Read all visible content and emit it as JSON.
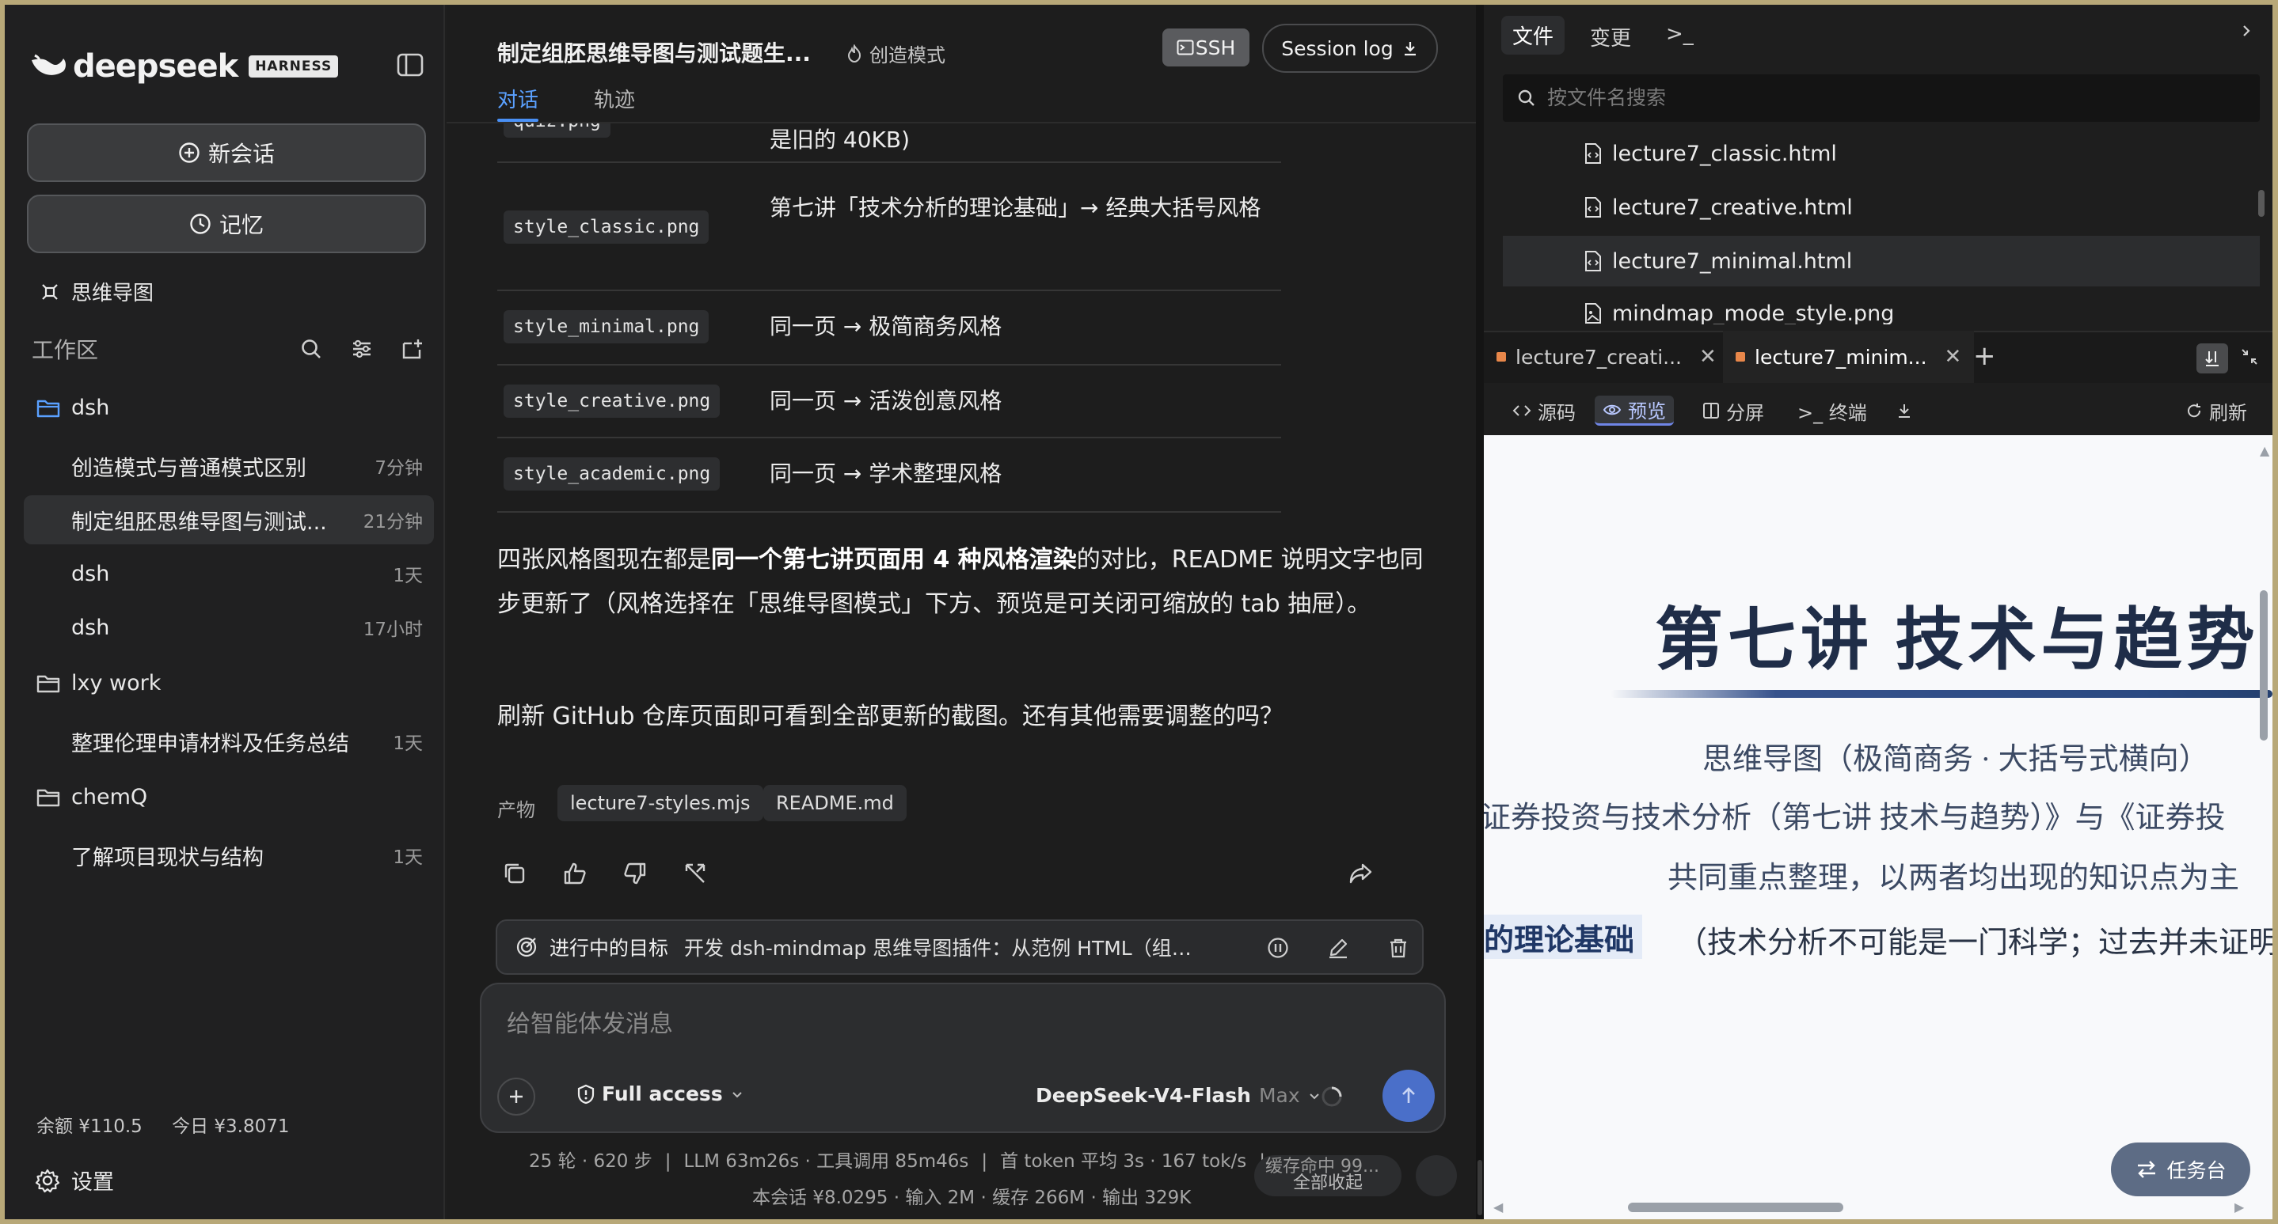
{
  "sidebar": {
    "brand": "deepseek",
    "badge": "HARNESS",
    "new_chat": "新会话",
    "memory": "记忆",
    "mindmap": "思维导图",
    "workspace_label": "工作区",
    "folders": [
      {
        "name": "dsh",
        "sessions": [
          {
            "title": "创造模式与普通模式区别",
            "time": "7分钟"
          },
          {
            "title": "制定组胚思维导图与测试...",
            "time": "21分钟"
          },
          {
            "title": "dsh",
            "time": "1天"
          },
          {
            "title": "dsh",
            "time": "17小时"
          }
        ]
      },
      {
        "name": "lxy work",
        "sessions": [
          {
            "title": "整理伦理申请材料及任务总结",
            "time": "1天"
          }
        ]
      },
      {
        "name": "chemQ",
        "sessions": [
          {
            "title": "了解项目现状与结构",
            "time": "1天"
          }
        ]
      }
    ],
    "balance": "余额 ¥110.5",
    "today": "今日 ¥3.8071",
    "settings": "设置"
  },
  "chat": {
    "title": "制定组胚思维导图与测试题生...",
    "mode": "创造模式",
    "ssh": "SSH",
    "session_log": "Session log",
    "tabs": [
      "对话",
      "轨迹"
    ],
    "partial_top_chip": "quiz.png",
    "partial_top_desc": "是旧的 40KB)",
    "table": [
      {
        "file": "style_classic.png",
        "desc": "第七讲「技术分析的理论基础」→ 经典大括号风格"
      },
      {
        "file": "style_minimal.png",
        "desc": "同一页 → 极简商务风格"
      },
      {
        "file": "style_creative.png",
        "desc": "同一页 → 活泼创意风格"
      },
      {
        "file": "style_academic.png",
        "desc": "同一页 → 学术整理风格"
      }
    ],
    "para1_a": "四张风格图现在都是",
    "para1_b": "同一个第七讲页面用 4 种风格渲染",
    "para1_c": "的对比，README 说明文字也同步更新了（风格选择在「思维导图模式」下方、预览是可关闭可缩放的 tab 抽屉）。",
    "para2": "刷新 GitHub 仓库页面即可看到全部更新的截图。还有其他需要调整的吗？",
    "products_label": "产物",
    "products": [
      "lecture7-styles.mjs",
      "README.md"
    ],
    "goal_label": "进行中的目标",
    "goal_text": "开发 dsh-mindmap 思维导图插件：从范例 HTML（组胚...",
    "composer_placeholder": "给智能体发消息",
    "access": "Full access",
    "model": "DeepSeek-V4-Flash",
    "model_tier": "Max",
    "stats_line1": [
      "25 轮 · 620 步",
      "LLM 63m26s · 工具调用 85m46s",
      "首 token 平均 3s · 167 tok/s"
    ],
    "cache": "缓存命中 99...",
    "collapse_all": "全部收起",
    "stats_line2": "本会话 ¥8.0295 · 输入 2M · 缓存 266M · 输出 329K"
  },
  "right": {
    "tabs": [
      "文件",
      "变更",
      ">_"
    ],
    "search_placeholder": "按文件名搜索",
    "files": [
      "lecture7_classic.html",
      "lecture7_creative.html",
      "lecture7_minimal.html",
      "mindmap_mode_style.png"
    ],
    "selected_file_index": 2,
    "editor_tabs": [
      "lecture7_creati...",
      "lecture7_minim..."
    ],
    "toolbar": {
      "source": "源码",
      "preview": "预览",
      "split": "分屏",
      "terminal": ">_ 终端",
      "refresh": "刷新"
    },
    "preview": {
      "title": "第七讲  技术与趋势",
      "subtitle": "思维导图（极简商务 · 大括号式横向）",
      "line1": "证券投资与技术分析（第七讲 技术与趋势）》与《证券投",
      "line2": "共同重点整理，以两者均出现的知识点为主",
      "highlight": "的理论基础",
      "note": "（技术分析不可能是一门科学；过去并未证明"
    },
    "task_button": "任务台"
  }
}
